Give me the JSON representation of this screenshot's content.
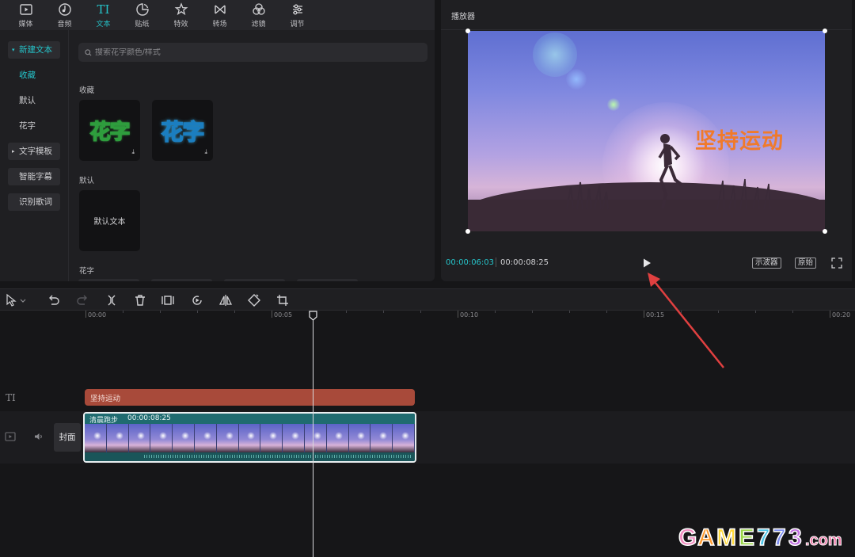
{
  "tabs": [
    {
      "label": "媒体",
      "icon": "media-icon"
    },
    {
      "label": "音频",
      "icon": "audio-icon"
    },
    {
      "label": "文本",
      "icon": "text-icon",
      "glyph": "TI",
      "active": true
    },
    {
      "label": "贴纸",
      "icon": "sticker-icon"
    },
    {
      "label": "特效",
      "icon": "effects-icon"
    },
    {
      "label": "转场",
      "icon": "transition-icon"
    },
    {
      "label": "滤镜",
      "icon": "filter-icon"
    },
    {
      "label": "调节",
      "icon": "adjust-icon"
    }
  ],
  "sidebar": {
    "new_text": "新建文本",
    "favorites": "收藏",
    "default": "默认",
    "fancy": "花字",
    "text_template": "文字模板",
    "smart_subtitle": "智能字幕",
    "recognize_lyrics": "识别歌词"
  },
  "search": {
    "placeholder": "搜索花字颜色/样式"
  },
  "sections": {
    "favorites": "收藏",
    "default": "默认",
    "fancy": "花字"
  },
  "cards": {
    "fancy_1": "花字",
    "fancy_2": "花字",
    "default_text": "默认文本"
  },
  "player": {
    "title": "播放器",
    "overlay_text": "坚持运动",
    "time_current": "00:00:06:03",
    "time_total": "00:00:08:25",
    "waveform_btn": "示波器",
    "original_btn": "原始"
  },
  "ruler": {
    "labels": [
      "00:00",
      "00:05",
      "00:10",
      "00:15",
      "00:20"
    ]
  },
  "timeline": {
    "text_track_glyph": "TI",
    "text_clip": "坚持运动",
    "cover": "封面",
    "video_clip_name": "清晨跑步",
    "video_clip_duration": "00:00:08:25"
  },
  "watermark": "GAME773.com",
  "colors": {
    "accent": "#25c3c9",
    "text_clip": "#a84a3a",
    "video_clip": "#1d5c63",
    "overlay_text": "#f07a2b",
    "arrow": "#e04040"
  }
}
